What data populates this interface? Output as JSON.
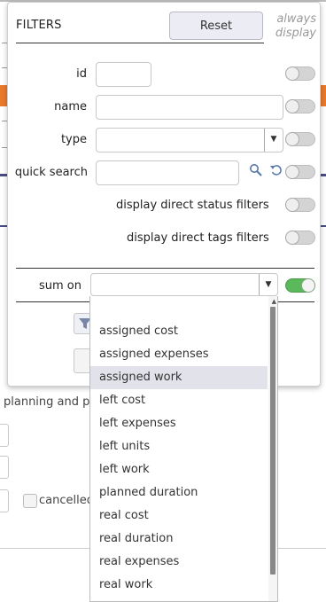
{
  "filters": {
    "title": "FILTERS",
    "reset_label": "Reset",
    "always_display_label": "always display",
    "fields": {
      "id_label": "id",
      "name_label": "name",
      "type_label": "type",
      "quick_search_label": "quick search"
    },
    "checks": {
      "direct_status": "display direct status filters",
      "direct_tags": "display direct tags filters"
    },
    "sum_on": {
      "label": "sum on",
      "selected": "",
      "toggle_on": true,
      "options": [
        "assigned cost",
        "assigned expenses",
        "assigned work",
        "left cost",
        "left expenses",
        "left units",
        "left work",
        "planned duration",
        "real cost",
        "real duration",
        "real expenses",
        "real work"
      ],
      "highlighted_option": "assigned work"
    }
  },
  "background": {
    "section_text": "planning and p",
    "cancelled_label": "cancelled"
  },
  "colors": {
    "toggle_on": "#5cb85c",
    "toggle_off": "#d4d4d4",
    "accent_orange": "#e8792b",
    "accent_navy": "#4a4a86"
  },
  "icons": {
    "search": "magnifier-icon",
    "reset_search": "undo-icon",
    "dropdown": "chevron-down-icon"
  }
}
